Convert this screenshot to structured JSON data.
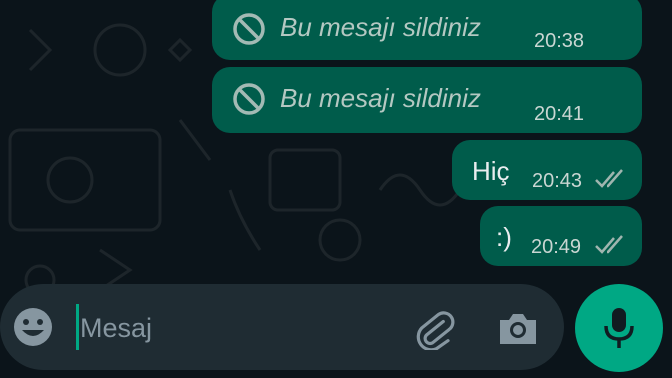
{
  "messages": [
    {
      "type": "deleted",
      "text": "Bu mesajı sildiniz",
      "time": "20:38",
      "icon": "deleted-icon"
    },
    {
      "type": "deleted",
      "text": "Bu mesajı sildiniz",
      "time": "20:41",
      "icon": "deleted-icon"
    },
    {
      "type": "sent",
      "text": "Hiç",
      "time": "20:43",
      "status": "delivered-double-tick"
    },
    {
      "type": "sent",
      "text": ":)",
      "time": "20:49",
      "status": "delivered-double-tick"
    }
  ],
  "composer": {
    "placeholder": "Mesaj",
    "value": "",
    "icons": [
      "emoji-icon",
      "attach-icon",
      "camera-icon",
      "mic-icon"
    ]
  },
  "colors": {
    "background": "#0b141a",
    "outgoing_bubble": "#005c4b",
    "input_bar": "#1f2c33",
    "accent": "#00a884"
  }
}
